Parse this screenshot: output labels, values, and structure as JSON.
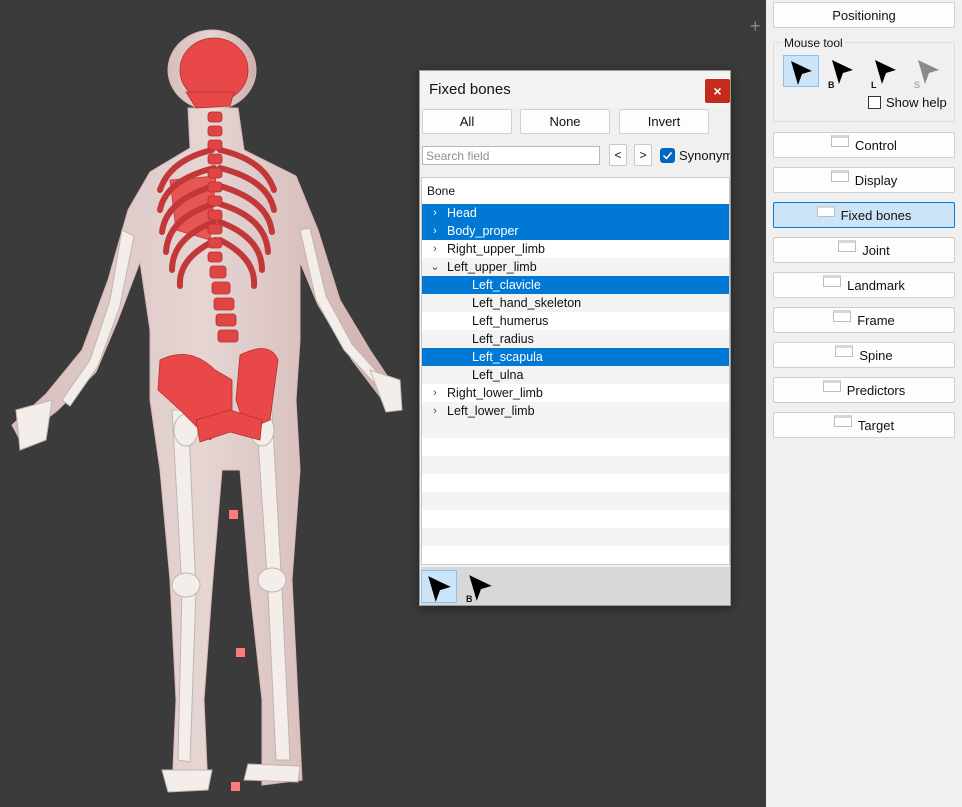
{
  "viewport": {
    "plus_glyph": "+"
  },
  "right_panel": {
    "positioning_label": "Positioning",
    "mouse_tool": {
      "group_label": "Mouse tool",
      "tools": [
        {
          "sub": "",
          "selected": true
        },
        {
          "sub": "B",
          "selected": false
        },
        {
          "sub": "L",
          "selected": false
        },
        {
          "sub": "S",
          "selected": false
        }
      ],
      "show_help_label": "Show help",
      "show_help_checked": false
    },
    "panel_buttons": [
      {
        "label": "Control",
        "active": false
      },
      {
        "label": "Display",
        "active": false
      },
      {
        "label": "Fixed bones",
        "active": true
      },
      {
        "label": "Joint",
        "active": false
      },
      {
        "label": "Landmark",
        "active": false
      },
      {
        "label": "Frame",
        "active": false
      },
      {
        "label": "Spine",
        "active": false
      },
      {
        "label": "Predictors",
        "active": false
      },
      {
        "label": "Target",
        "active": false
      }
    ]
  },
  "dialog": {
    "title": "Fixed bones",
    "close_glyph": "×",
    "all_label": "All",
    "none_label": "None",
    "invert_label": "Invert",
    "search_placeholder": "Search field",
    "prev_label": "<",
    "next_label": ">",
    "synonyms_label": "Synonyms",
    "synonyms_checked": true,
    "tree_header": "Bone",
    "rows": [
      {
        "label": "Head",
        "level": 0,
        "expander": "›",
        "selected": true
      },
      {
        "label": "Body_proper",
        "level": 0,
        "expander": "›",
        "selected": true
      },
      {
        "label": "Right_upper_limb",
        "level": 0,
        "expander": "›",
        "selected": false
      },
      {
        "label": "Left_upper_limb",
        "level": 0,
        "expander": "⌄",
        "selected": false
      },
      {
        "label": "Left_clavicle",
        "level": 1,
        "expander": "",
        "selected": true
      },
      {
        "label": "Left_hand_skeleton",
        "level": 1,
        "expander": "",
        "selected": false
      },
      {
        "label": "Left_humerus",
        "level": 1,
        "expander": "",
        "selected": false
      },
      {
        "label": "Left_radius",
        "level": 1,
        "expander": "",
        "selected": false
      },
      {
        "label": "Left_scapula",
        "level": 1,
        "expander": "",
        "selected": true
      },
      {
        "label": "Left_ulna",
        "level": 1,
        "expander": "",
        "selected": false
      },
      {
        "label": "Right_lower_limb",
        "level": 0,
        "expander": "›",
        "selected": false
      },
      {
        "label": "Left_lower_limb",
        "level": 0,
        "expander": "›",
        "selected": false
      }
    ],
    "bottom_tools": [
      {
        "sub": "",
        "selected": true
      },
      {
        "sub": "B",
        "selected": false
      }
    ]
  },
  "colors": {
    "accent": "#0078d4",
    "bone_highlight": "#e84848",
    "close": "#c42b1c"
  }
}
